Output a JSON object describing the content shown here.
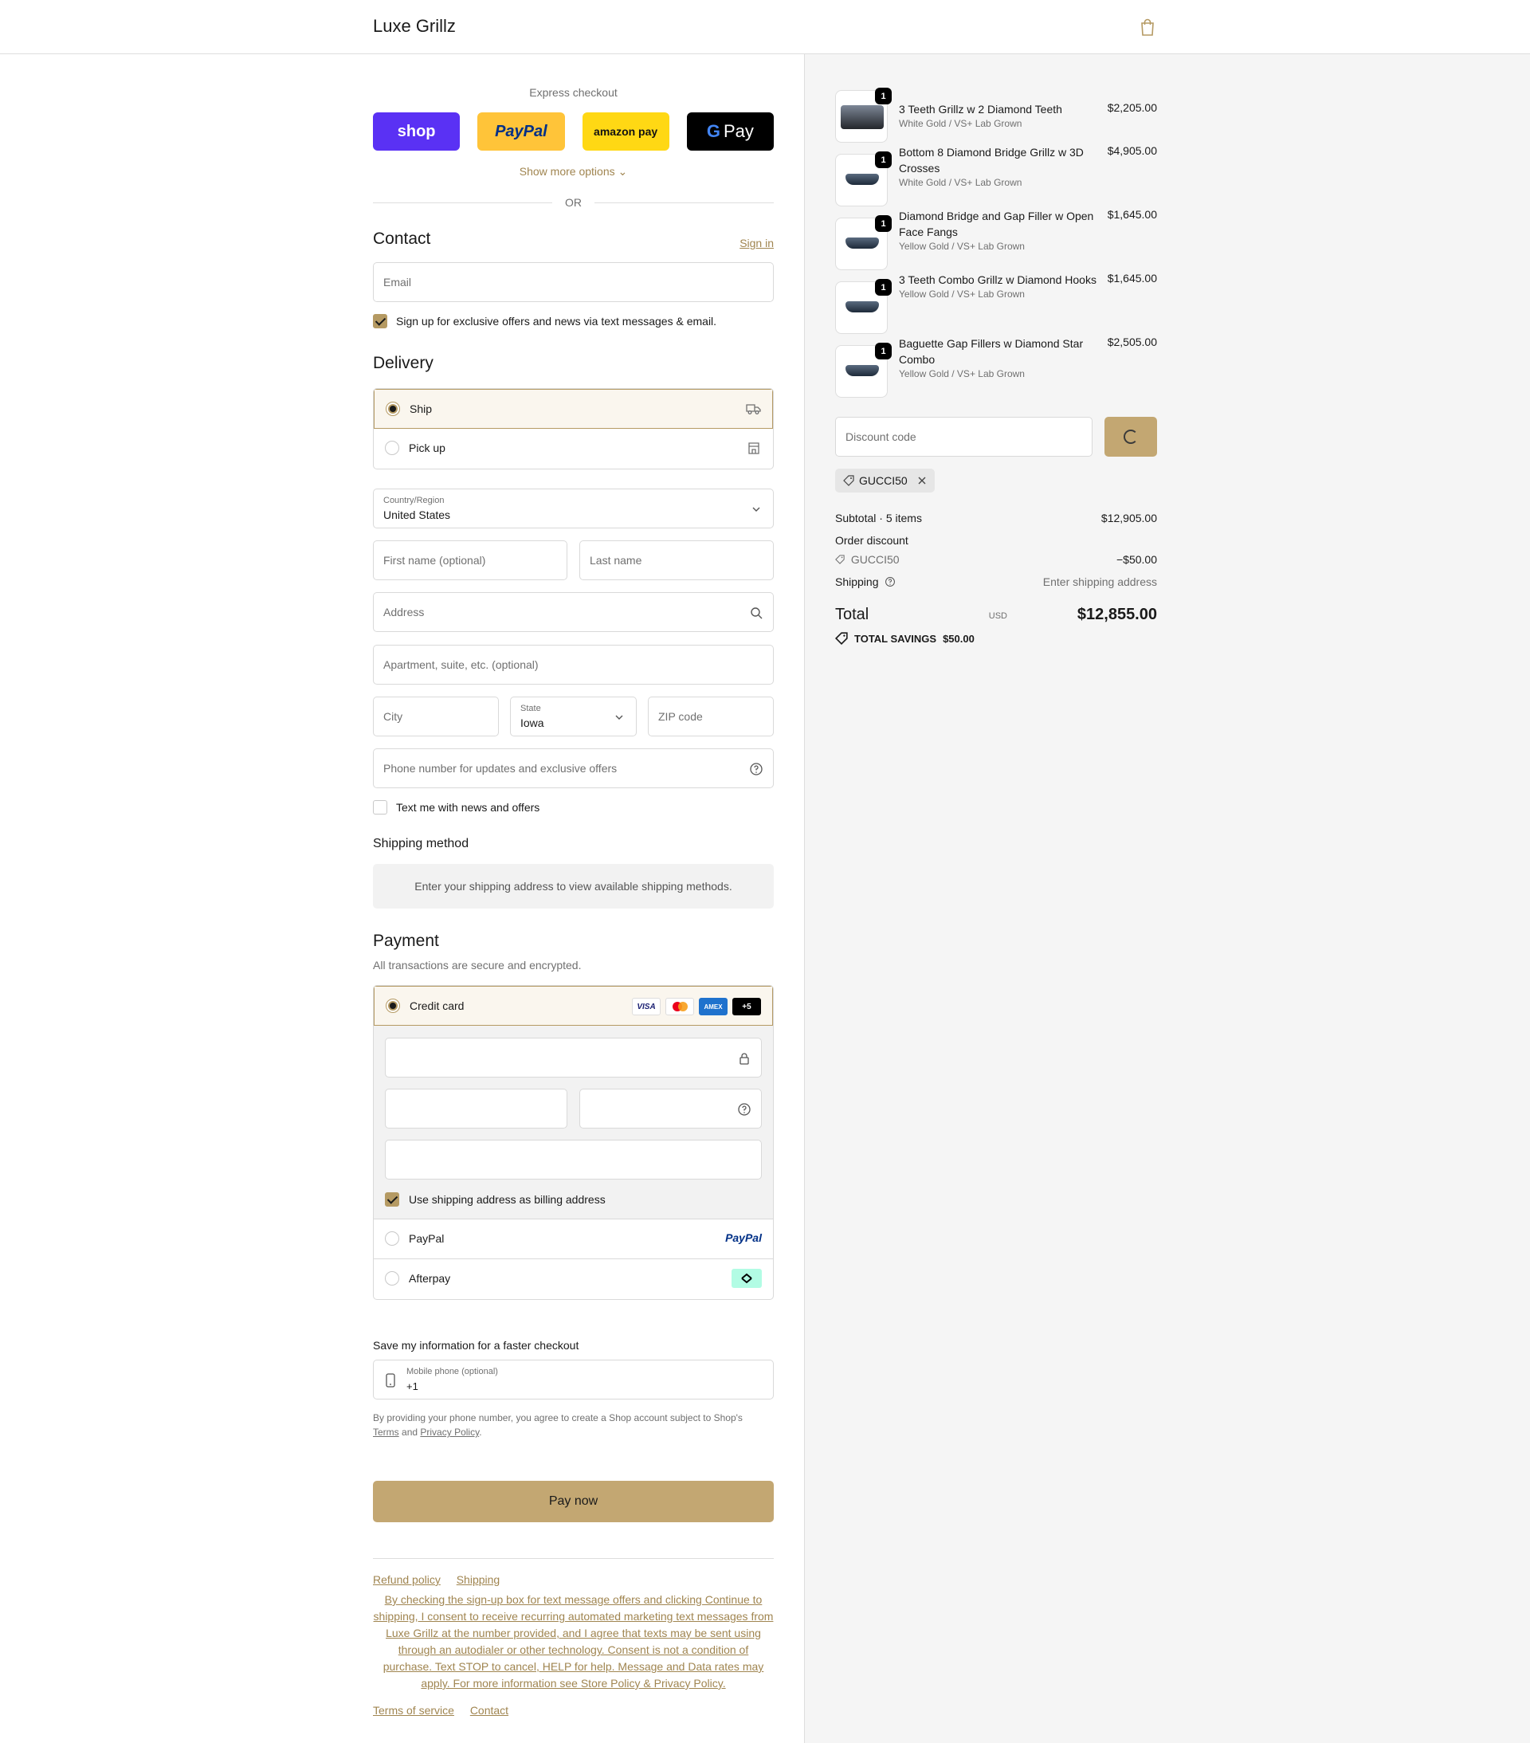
{
  "header": {
    "store_name": "Luxe Grillz"
  },
  "express": {
    "label": "Express checkout",
    "shop": "shop",
    "paypal": "PayPal",
    "amazon": "amazon pay",
    "gpay_g": "G",
    "gpay": "Pay",
    "show_more": "Show more options ⌄",
    "or": "OR"
  },
  "contact": {
    "heading": "Contact",
    "sign_in": "Sign in",
    "email_placeholder": "Email",
    "signup_label": "Sign up for exclusive offers and news via text messages & email.",
    "signup_checked": true
  },
  "delivery": {
    "heading": "Delivery",
    "options": [
      {
        "label": "Ship",
        "selected": true,
        "icon": "truck-icon"
      },
      {
        "label": "Pick up",
        "selected": false,
        "icon": "store-icon"
      }
    ],
    "country_label": "Country/Region",
    "country_value": "United States",
    "first_name_placeholder": "First name (optional)",
    "last_name_placeholder": "Last name",
    "address_placeholder": "Address",
    "apartment_placeholder": "Apartment, suite, etc. (optional)",
    "city_placeholder": "City",
    "state_label": "State",
    "state_value": "Iowa",
    "zip_placeholder": "ZIP code",
    "phone_placeholder": "Phone number for updates and exclusive offers",
    "text_me_label": "Text me with news and offers",
    "text_me_checked": false
  },
  "shipping_method": {
    "heading": "Shipping method",
    "info": "Enter your shipping address to view available shipping methods."
  },
  "payment": {
    "heading": "Payment",
    "subtitle": "All transactions are secure and encrypted.",
    "credit_card_label": "Credit card",
    "card_logos": [
      "VISA",
      "",
      "AMEX",
      "+5"
    ],
    "billing_label": "Use shipping address as billing address",
    "billing_checked": true,
    "paypal_label": "PayPal",
    "paypal_logo": "PayPal",
    "afterpay_label": "Afterpay"
  },
  "save_info": {
    "heading": "Save my information for a faster checkout",
    "mobile_label": "Mobile phone (optional)",
    "mobile_value": "+1",
    "disclaimer_pre": "By providing your phone number, you agree to create a Shop account subject to Shop's",
    "terms": "Terms",
    "and": "and",
    "privacy": "Privacy Policy",
    "period": "."
  },
  "pay_now": "Pay now",
  "footer": {
    "refund": "Refund policy",
    "shipping": "Shipping",
    "consent": "By checking the sign-up box for text message offers and clicking Continue to shipping, I consent to receive recurring automated marketing text messages from Luxe Grillz at the number provided, and I agree that texts may be sent using through an autodialer or other technology. Consent is not a condition of purchase. Text STOP to cancel, HELP for help. Message and Data rates may apply. For more information see Store Policy & Privacy Policy.",
    "terms_of_service": "Terms of service",
    "contact": "Contact"
  },
  "cart": {
    "items": [
      {
        "qty": "1",
        "name": "3 Teeth Grillz w 2 Diamond Teeth",
        "variant": "White Gold / VS+ Lab Grown",
        "price": "$2,205.00"
      },
      {
        "qty": "1",
        "name": "Bottom 8 Diamond Bridge Grillz w 3D Crosses",
        "variant": "White Gold / VS+ Lab Grown",
        "price": "$4,905.00"
      },
      {
        "qty": "1",
        "name": "Diamond Bridge and Gap Filler w Open Face Fangs",
        "variant": "Yellow Gold / VS+ Lab Grown",
        "price": "$1,645.00"
      },
      {
        "qty": "1",
        "name": "3 Teeth Combo Grillz w Diamond Hooks",
        "variant": "Yellow Gold / VS+ Lab Grown",
        "price": "$1,645.00"
      },
      {
        "qty": "1",
        "name": "Baguette Gap Fillers w Diamond Star Combo",
        "variant": "Yellow Gold / VS+ Lab Grown",
        "price": "$2,505.00"
      }
    ],
    "discount_placeholder": "Discount code",
    "applied_code": "GUCCI50",
    "subtotal_label": "Subtotal · 5 items",
    "subtotal_value": "$12,905.00",
    "order_discount_label": "Order discount",
    "discount_code": "GUCCI50",
    "discount_value": "−$50.00",
    "shipping_label": "Shipping",
    "shipping_value": "Enter shipping address",
    "total_label": "Total",
    "total_currency": "USD",
    "total_value": "$12,855.00",
    "savings_label": "TOTAL SAVINGS",
    "savings_value": "$50.00"
  },
  "colors": {
    "accent": "#c3a772",
    "link": "#a08550",
    "shop": "#5a31f4",
    "paypal": "#ffc439"
  }
}
